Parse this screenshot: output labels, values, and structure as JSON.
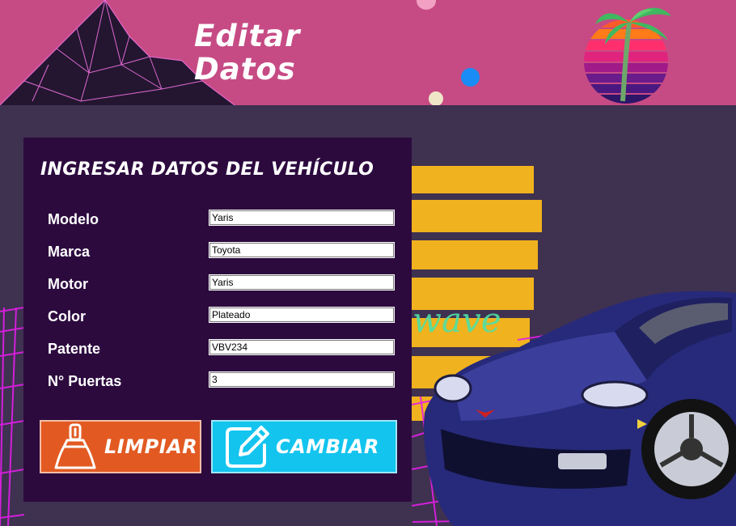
{
  "header": {
    "title_line1": "Editar",
    "title_line2": "Datos"
  },
  "background": {
    "logo_text": "wave"
  },
  "form": {
    "title": "INGRESAR DATOS DEL VEHÍCULO",
    "fields": [
      {
        "label": "Modelo",
        "value": "Yaris"
      },
      {
        "label": "Marca",
        "value": "Toyota"
      },
      {
        "label": "Motor",
        "value": "Yaris"
      },
      {
        "label": "Color",
        "value": "Plateado"
      },
      {
        "label": "Patente",
        "value": "VBV234"
      },
      {
        "label": "N° Puertas",
        "value": "3"
      }
    ]
  },
  "buttons": {
    "clear_label": "LIMPIAR",
    "change_label": "CAMBIAR"
  },
  "colors": {
    "header": "#c64b84",
    "panel": "#2c0a3e",
    "clear_button": "#e25a22",
    "change_button": "#13c4ee",
    "sun": "#f0b21e"
  },
  "icons": {
    "clear": "dustpan-icon",
    "change": "edit-pencil-icon"
  }
}
